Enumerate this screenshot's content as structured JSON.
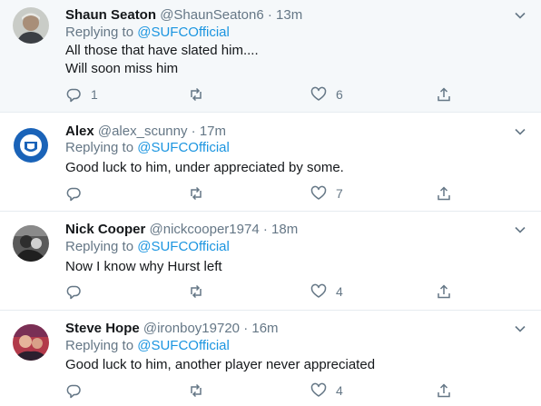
{
  "tweets": [
    {
      "name": "Shaun Seaton",
      "handle": "@ShaunSeaton6",
      "time": "13m",
      "replying_prefix": "Replying to",
      "replying_to": "@SUFCOfficial",
      "text_lines": [
        "All those that have slated him....",
        "Will soon miss him"
      ],
      "replies": "1",
      "retweets": "",
      "likes": "6"
    },
    {
      "name": "Alex",
      "handle": "@alex_scunny",
      "time": "17m",
      "replying_prefix": "Replying to",
      "replying_to": "@SUFCOfficial",
      "text_lines": [
        "Good luck to him, under appreciated by some."
      ],
      "replies": "",
      "retweets": "",
      "likes": "7"
    },
    {
      "name": "Nick Cooper",
      "handle": "@nickcooper1974",
      "time": "18m",
      "replying_prefix": "Replying to",
      "replying_to": "@SUFCOfficial",
      "text_lines": [
        "Now I know why Hurst left"
      ],
      "replies": "",
      "retweets": "",
      "likes": "4"
    },
    {
      "name": "Steve Hope",
      "handle": "@ironboy19720",
      "time": "16m",
      "replying_prefix": "Replying to",
      "replying_to": "@SUFCOfficial",
      "text_lines": [
        "Good luck to him, another player never appreciated"
      ],
      "replies": "",
      "retweets": "",
      "likes": "4"
    }
  ],
  "separator": "·",
  "colors": {
    "link": "#1b95e0",
    "secondary": "#657786",
    "highlight_bg": "#f5f8fa",
    "border": "#e6ecf0"
  },
  "icons": {
    "reply": "reply-icon",
    "retweet": "retweet-icon",
    "like": "heart-icon",
    "share": "share-icon",
    "more": "chevron-down-icon"
  }
}
